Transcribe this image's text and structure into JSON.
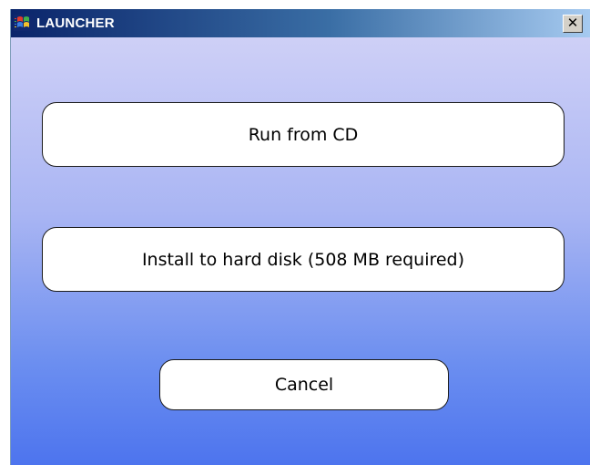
{
  "window": {
    "title": "LAUNCHER",
    "close_label": "✕"
  },
  "icons": {
    "app": "windows-flag-icon",
    "close": "close-icon"
  },
  "buttons": {
    "run_label": "Run from CD",
    "install_label": "Install to hard disk (508 MB required)",
    "cancel_label": "Cancel"
  },
  "colors": {
    "titlebar_start": "#0a246a",
    "titlebar_end": "#a6caf0",
    "background_top": "#d4d4f7",
    "background_bottom": "#4d74ee",
    "button_fill": "#ffffff",
    "button_border": "#1c1c1c"
  }
}
